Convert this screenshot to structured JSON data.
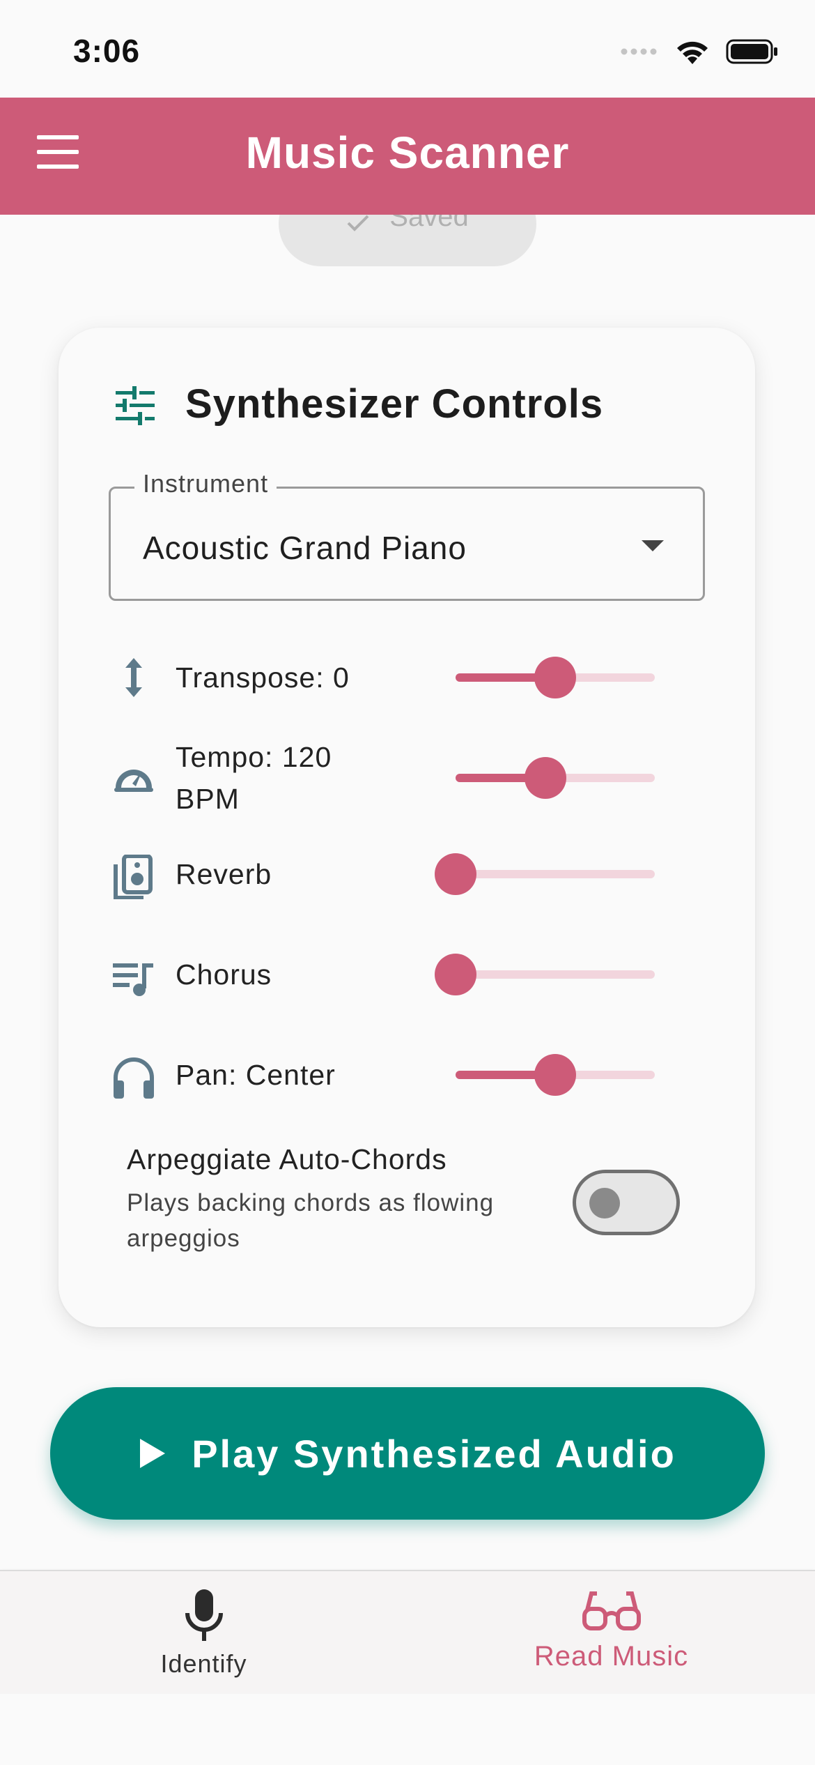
{
  "status_bar": {
    "time": "3:06"
  },
  "app_bar": {
    "title": "Music Scanner"
  },
  "saved_chip": {
    "label": "Saved"
  },
  "card": {
    "title": "Synthesizer Controls",
    "instrument": {
      "label": "Instrument",
      "value": "Acoustic Grand Piano"
    },
    "controls": [
      {
        "label": "Transpose: 0",
        "icon": "swap-vertical-icon",
        "fraction": 0.5
      },
      {
        "label_line1": "Tempo: 120",
        "label_line2": "BPM",
        "icon": "speedometer-icon",
        "fraction": 0.45
      },
      {
        "label": "Reverb",
        "icon": "speaker-icon",
        "fraction": 0.0
      },
      {
        "label": "Chorus",
        "icon": "queue-music-icon",
        "fraction": 0.0
      },
      {
        "label": "Pan: Center",
        "icon": "headphones-icon",
        "fraction": 0.5
      }
    ],
    "arpeggiate": {
      "title": "Arpeggiate Auto-Chords",
      "subtitle": "Plays backing chords as flowing arpeggios",
      "enabled": false
    }
  },
  "play_button": {
    "label": "Play Synthesized Audio"
  },
  "bottom_nav": {
    "items": [
      {
        "label": "Identify",
        "icon": "microphone-icon",
        "active": false
      },
      {
        "label": "Read Music",
        "icon": "reading-glasses-icon",
        "active": true
      }
    ]
  },
  "colors": {
    "primary": "#cd5b78",
    "accent": "#00897b",
    "icon_teal": "#137a6c",
    "icon_slate": "#5e7a8a"
  }
}
